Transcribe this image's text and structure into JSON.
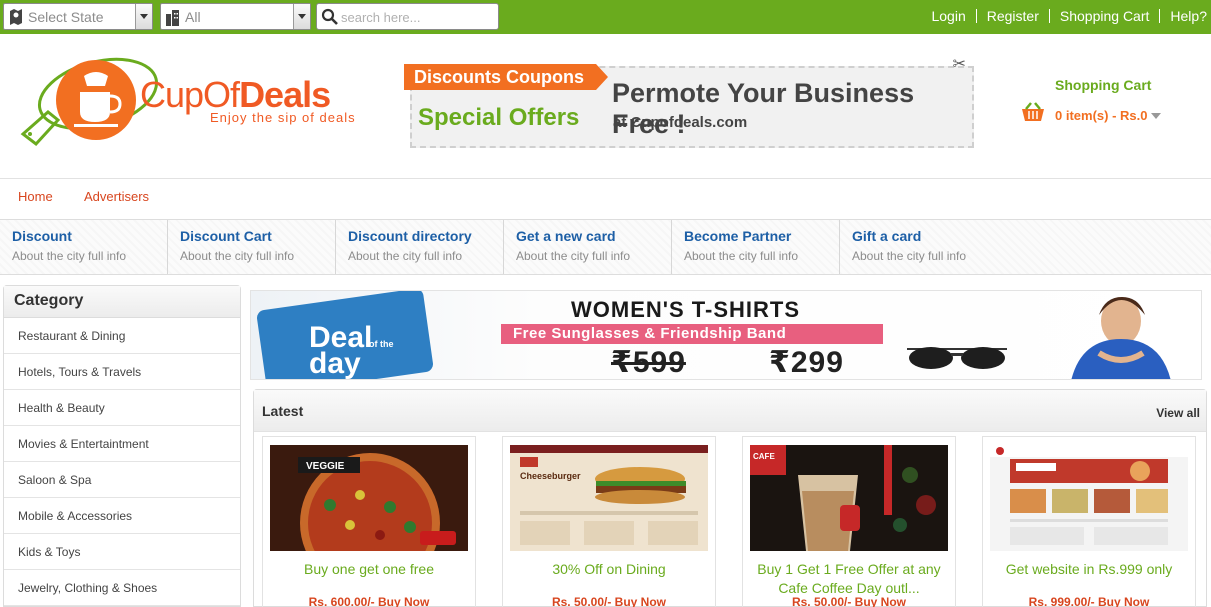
{
  "topbar": {
    "state_select": "Select State",
    "city_select": "All",
    "search_placeholder": "search here...",
    "links": [
      "Login",
      "Register",
      "Shopping Cart",
      "Help?"
    ]
  },
  "brand": {
    "name_part1": "Cup",
    "name_part2": "Of",
    "name_part3": "Deals",
    "tagline": "Enjoy the sip of deals"
  },
  "promo": {
    "tag": "Discounts Coupons",
    "special": "Special Offers",
    "headline": "Permote Your Business Free !",
    "sub": "at Cupofdeals.com"
  },
  "cart": {
    "title": "Shopping Cart",
    "items": "0 item(s) - Rs.0"
  },
  "menu": [
    "Home",
    "Advertisers"
  ],
  "features": [
    {
      "title": "Discount",
      "sub": "About the city full info"
    },
    {
      "title": "Discount Cart",
      "sub": "About the city full info"
    },
    {
      "title": "Discount directory",
      "sub": "About the city full info"
    },
    {
      "title": "Get a new card",
      "sub": "About the city full info"
    },
    {
      "title": "Become Partner",
      "sub": "About the city full info"
    },
    {
      "title": "Gift a card",
      "sub": "About the city full info"
    }
  ],
  "sidebar": {
    "title": "Category",
    "items": [
      "Restaurant & Dining",
      "Hotels, Tours & Travels",
      "Health & Beauty",
      "Movies & Entertaintment",
      "Saloon & Spa",
      "Mobile & Accessories",
      "Kids & Toys",
      "Jewelry, Clothing & Shoes"
    ]
  },
  "banner": {
    "deal_line1": "Deal",
    "deal_line2": "day",
    "deal_small": "of the",
    "title": "WOMEN'S T-SHIRTS",
    "strip": "Free Sunglasses & Friendship Band",
    "old_price": "₹599",
    "new_price": "₹299"
  },
  "latest": {
    "title": "Latest",
    "view_all": "View all",
    "cards": [
      {
        "title": "Buy one get one free",
        "price": "Rs. 600.00/- Buy Now",
        "image": "pizza-image"
      },
      {
        "title": "30% Off on Dining",
        "price": "Rs. 50.00/- Buy Now",
        "image": "burger-website-image"
      },
      {
        "title": "Buy 1 Get 1 Free Offer at any Cafe Coffee Day outl...",
        "price": "Rs. 50.00/- Buy Now",
        "image": "coffee-image"
      },
      {
        "title": "Get website in Rs.999 only",
        "price": "Rs. 999.00/- Buy Now",
        "image": "restaurant-website-image"
      }
    ]
  },
  "colors": {
    "brand_green": "#6aab1e",
    "brand_orange": "#f05a24",
    "link_blue": "#1d5fa6",
    "price_red": "#d8461f"
  }
}
